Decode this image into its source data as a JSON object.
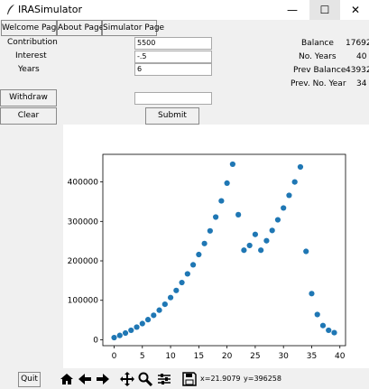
{
  "window": {
    "title": "IRASimulator",
    "minimize": "—",
    "maximize": "☐",
    "close": "✕"
  },
  "tabs": {
    "welcome": "Welcome Page",
    "about": "About Page",
    "simulator": "Simulator Page"
  },
  "form": {
    "contribution_label": "Contribution",
    "contribution_value": "5500",
    "interest_label": "Interest",
    "interest_value": "-.5",
    "years_label": "Years",
    "years_value": "6",
    "withdraw_label": "Withdraw",
    "withdraw_value": "",
    "clear_label": "Clear",
    "submit_label": "Submit"
  },
  "stats": {
    "balance_label": "Balance",
    "balance_value": "17692",
    "no_years_label": "No. Years",
    "no_years_value": "40",
    "prev_balance_label": "Prev Balance",
    "prev_balance_value": "43932",
    "prev_no_year_label": "Prev. No. Year",
    "prev_no_year_value": "34"
  },
  "toolbar": {
    "quit_label": "Quit",
    "x_readout": "x=21.9079",
    "y_readout": "y=396258"
  },
  "chart_data": {
    "type": "scatter",
    "x": [
      0,
      1,
      2,
      3,
      4,
      5,
      6,
      7,
      8,
      9,
      10,
      11,
      12,
      13,
      14,
      15,
      16,
      17,
      18,
      19,
      20,
      21,
      22,
      23,
      24,
      25,
      26,
      27,
      28,
      29,
      30,
      31,
      32,
      33,
      34,
      35,
      36,
      37,
      38,
      39
    ],
    "y": [
      5500,
      11000,
      17000,
      24000,
      32000,
      41000,
      51000,
      62000,
      75000,
      90000,
      107000,
      125000,
      145000,
      167000,
      190000,
      216000,
      244000,
      276000,
      311000,
      352000,
      397000,
      445000,
      317000,
      227000,
      239000,
      267000,
      227000,
      251000,
      277000,
      304000,
      334000,
      366000,
      400000,
      438000,
      224000,
      117000,
      64000,
      36000,
      24000,
      18000
    ],
    "color": "#1f77b4",
    "xlim": [
      -2,
      41
    ],
    "ylim": [
      -15000,
      470000
    ],
    "x_ticks": [
      0,
      5,
      10,
      15,
      20,
      25,
      30,
      35,
      40
    ],
    "y_ticks": [
      0,
      100000,
      200000,
      300000,
      400000
    ],
    "x_tick_labels": [
      "0",
      "5",
      "10",
      "15",
      "20",
      "25",
      "30",
      "35",
      "40"
    ],
    "y_tick_labels": [
      "0",
      "100000",
      "200000",
      "300000",
      "400000"
    ],
    "grid": false
  }
}
